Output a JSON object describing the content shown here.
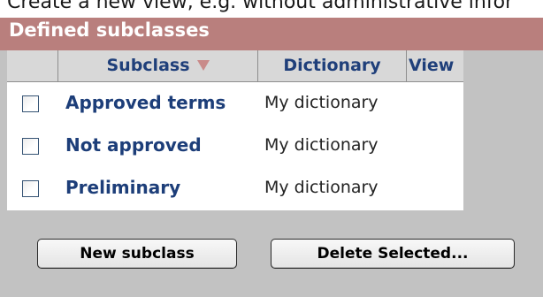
{
  "intro_text": "Create a new view, e.g. without administrative infor",
  "panel": {
    "title": "Defined subclasses"
  },
  "table": {
    "headers": {
      "subclass": "Subclass",
      "dictionary": "Dictionary",
      "view": "View"
    },
    "sort_icon": "sort-descending-icon",
    "rows": [
      {
        "subclass": "Approved terms",
        "dictionary": "My dictionary"
      },
      {
        "subclass": "Not approved",
        "dictionary": "My dictionary"
      },
      {
        "subclass": "Preliminary",
        "dictionary": "My dictionary"
      }
    ]
  },
  "buttons": {
    "new_subclass": "New subclass",
    "delete_selected": "Delete Selected..."
  },
  "colors": {
    "header_bar": "#b97f7d",
    "link_text": "#1d3e79",
    "panel_background": "#c2c2c2"
  }
}
